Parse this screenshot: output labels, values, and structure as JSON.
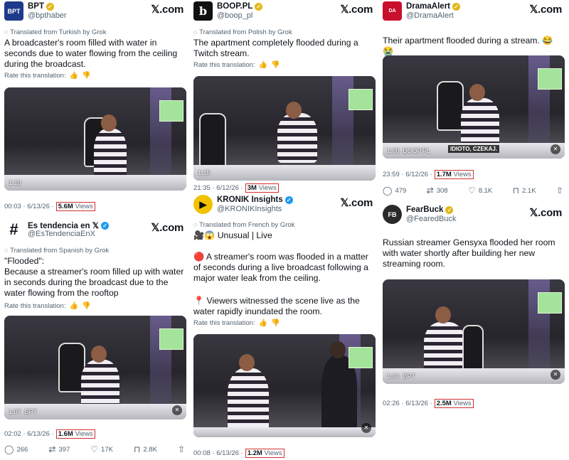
{
  "x_logo": "𝕏.com",
  "rate_label": "Rate this translation:",
  "cards": {
    "bpt": {
      "name": "BPT",
      "handle": "@bpthaber",
      "translated": "Translated from Turkish by Grok",
      "text": "A broadcaster's room filled with water in seconds due to water flowing from the ceiling during the broadcast.",
      "video_time": "1:10",
      "meta_time": "00:03 · 6/13/26 ·",
      "views": "5.6M",
      "views_label": "Views"
    },
    "boop": {
      "name": "BOOP.PL",
      "handle": "@boop_pl",
      "translated": "Translated from Polish by Grok",
      "text": "The apartment completely flooded during a Twitch stream.",
      "video_time": "1:15",
      "meta_time": "21:35 · 6/12/26 ·",
      "views": "3M",
      "views_label": "Views"
    },
    "drama": {
      "name": "DramaAlert",
      "handle": "@DramaAlert",
      "text": "Their apartment flooded during a stream. 😂😭",
      "video_time": "1:08",
      "video_source": "BOOP.PL",
      "video_caption": "IDIOTO, CZEKAJ.",
      "meta_time": "23:59 · 6/12/26 ·",
      "views": "1.7M",
      "views_label": "Views",
      "replies": "479",
      "reposts": "308",
      "likes": "8.1K",
      "bookmarks": "2.1K"
    },
    "tendencia": {
      "name": "Es tendencia en 𝕏",
      "handle": "@EsTendenciaEnX",
      "translated": "Translated from Spanish by Grok",
      "text_line1": "\"Flooded\":",
      "text": "Because a streamer's room filled up with water in seconds during the broadcast due to the water flowing from the rooftop",
      "video_time": "1:07",
      "video_source": "BPT",
      "meta_time": "02:02 · 6/13/26 ·",
      "views": "1.6M",
      "views_label": "Views",
      "replies": "266",
      "reposts": "397",
      "likes": "17K",
      "bookmarks": "2.8K"
    },
    "kronik": {
      "name": "KRONIK Insights",
      "handle": "@KRONIKInsights",
      "translated": "Translated from French by Grok",
      "text_line1": "🎥😱 Unusual | Live",
      "text_p1": "🔴 A streamer's room was flooded in a matter of seconds during a live broadcast following a major water leak from the ceiling.",
      "text_p2": "📍 Viewers witnessed the scene live as the water rapidly inundated the room.",
      "meta_time": "00:08 · 6/13/26 ·",
      "views": "1.2M",
      "views_label": "Views"
    },
    "fearbuck": {
      "name": "FearBuck",
      "handle": "@FearedBuck",
      "text": "Russian streamer Gensyxa flooded her room with water shortly after building her new streaming room.",
      "video_time": "1:04",
      "video_source": "BPT",
      "meta_time": "02:26 · 6/13/26 ·",
      "views": "2.5M",
      "views_label": "Views"
    }
  },
  "icons": {
    "translate": "globe-icon",
    "thumbs_up": "thumbs-up-icon",
    "thumbs_down": "thumbs-down-icon",
    "reply": "reply-icon",
    "repost": "repost-icon",
    "like": "heart-icon",
    "bookmark": "bookmark-icon",
    "share": "share-icon",
    "mute": "mute-icon"
  },
  "colors": {
    "views_outline": "#d32f2f",
    "verified_gold": "#e2b719",
    "verified_blue": "#1d9bf0",
    "muted_text": "#536471"
  }
}
